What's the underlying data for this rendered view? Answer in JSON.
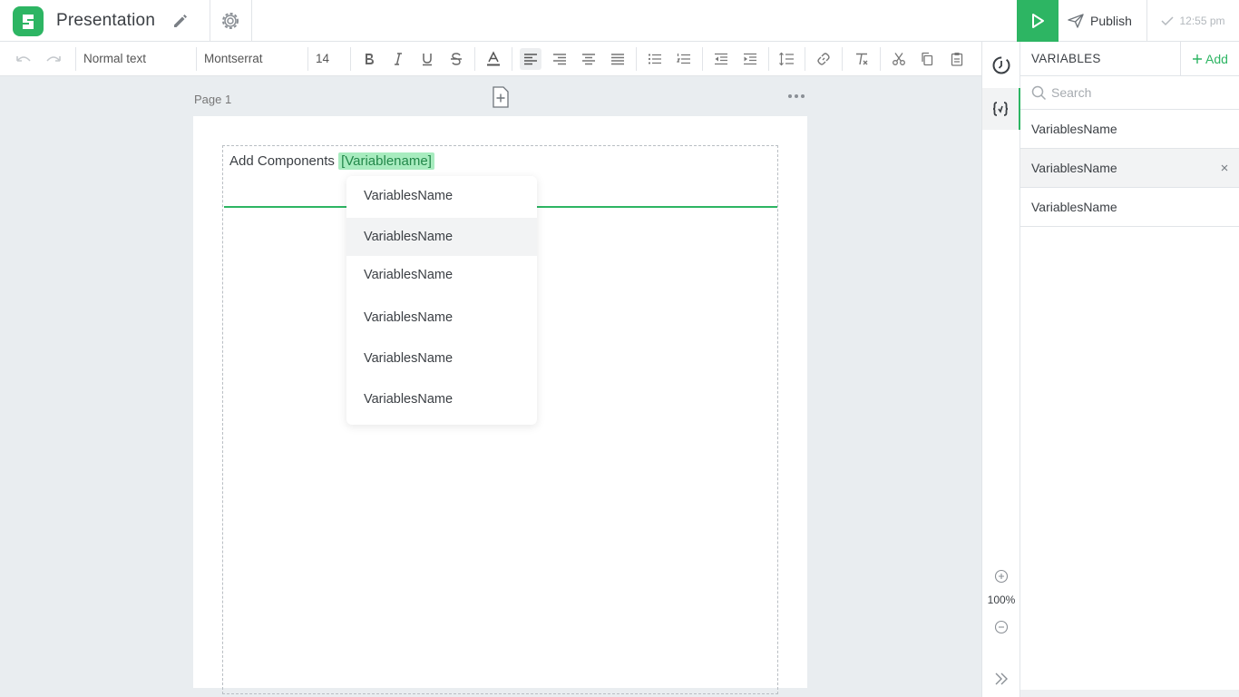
{
  "header": {
    "title": "Presentation",
    "publish_label": "Publish",
    "saved_time": "12:55 pm"
  },
  "toolbar": {
    "text_style": "Normal text",
    "font_family": "Montserrat",
    "font_size": "14"
  },
  "canvas": {
    "page_label": "Page 1",
    "component_text": "Add Components",
    "variable_chip": "[Variablename]"
  },
  "dropdown": {
    "items": [
      "VariablesName",
      "VariablesName",
      "VariablesName",
      "VariablesName",
      "VariablesName",
      "VariablesName"
    ],
    "hovered_index": 1
  },
  "rail": {
    "zoom_level": "100%"
  },
  "variables_panel": {
    "title": "VARIABLES",
    "add_label": "Add",
    "search_placeholder": "Search",
    "items": [
      "VariablesName",
      "VariablesName",
      "VariablesName"
    ],
    "selected_index": 1
  },
  "colors": {
    "accent": "#2db563",
    "chip_bg": "#a8ecbf"
  }
}
